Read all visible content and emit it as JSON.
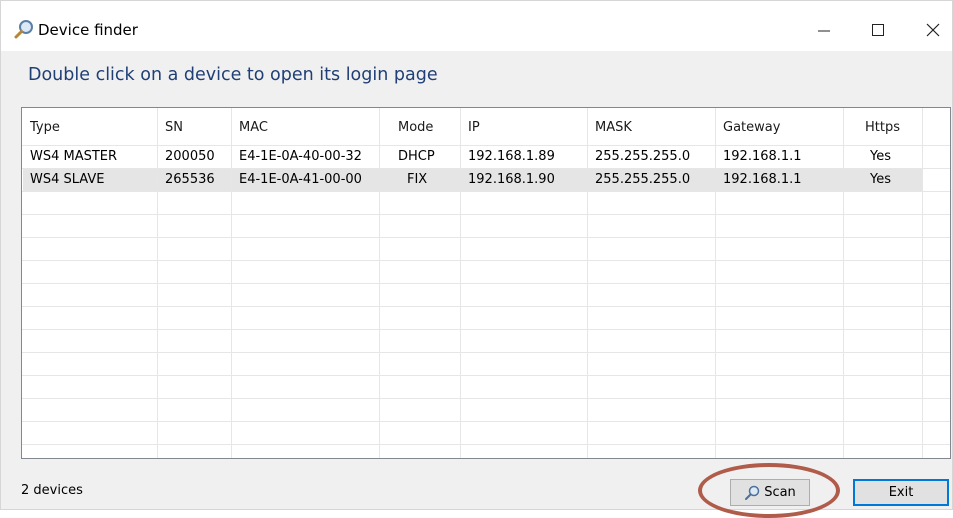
{
  "window": {
    "title": "Device finder"
  },
  "instruction": "Double click on a device to open its login page",
  "table": {
    "columns": [
      "Type",
      "SN",
      "MAC",
      "Mode",
      "IP",
      "MASK",
      "Gateway",
      "Https"
    ],
    "rows": [
      [
        "WS4 MASTER",
        "200050",
        "E4-1E-0A-40-00-32",
        "DHCP",
        "192.168.1.89",
        "255.255.255.0",
        "192.168.1.1",
        "Yes"
      ],
      [
        "WS4 SLAVE",
        "265536",
        "E4-1E-0A-41-00-00",
        "FIX",
        "192.168.1.90",
        "255.255.255.0",
        "192.168.1.1",
        "Yes"
      ]
    ],
    "selected_row": 1
  },
  "status": "2 devices",
  "buttons": {
    "scan": "Scan",
    "exit": "Exit"
  },
  "colors": {
    "instruction": "#1f3f75",
    "highlight_ring": "#b05c4a",
    "focus_border": "#0078d7"
  },
  "icons": {
    "app": "search-icon",
    "minimize": "minimize-icon",
    "maximize": "maximize-icon",
    "close": "close-icon",
    "scan": "search-icon"
  }
}
